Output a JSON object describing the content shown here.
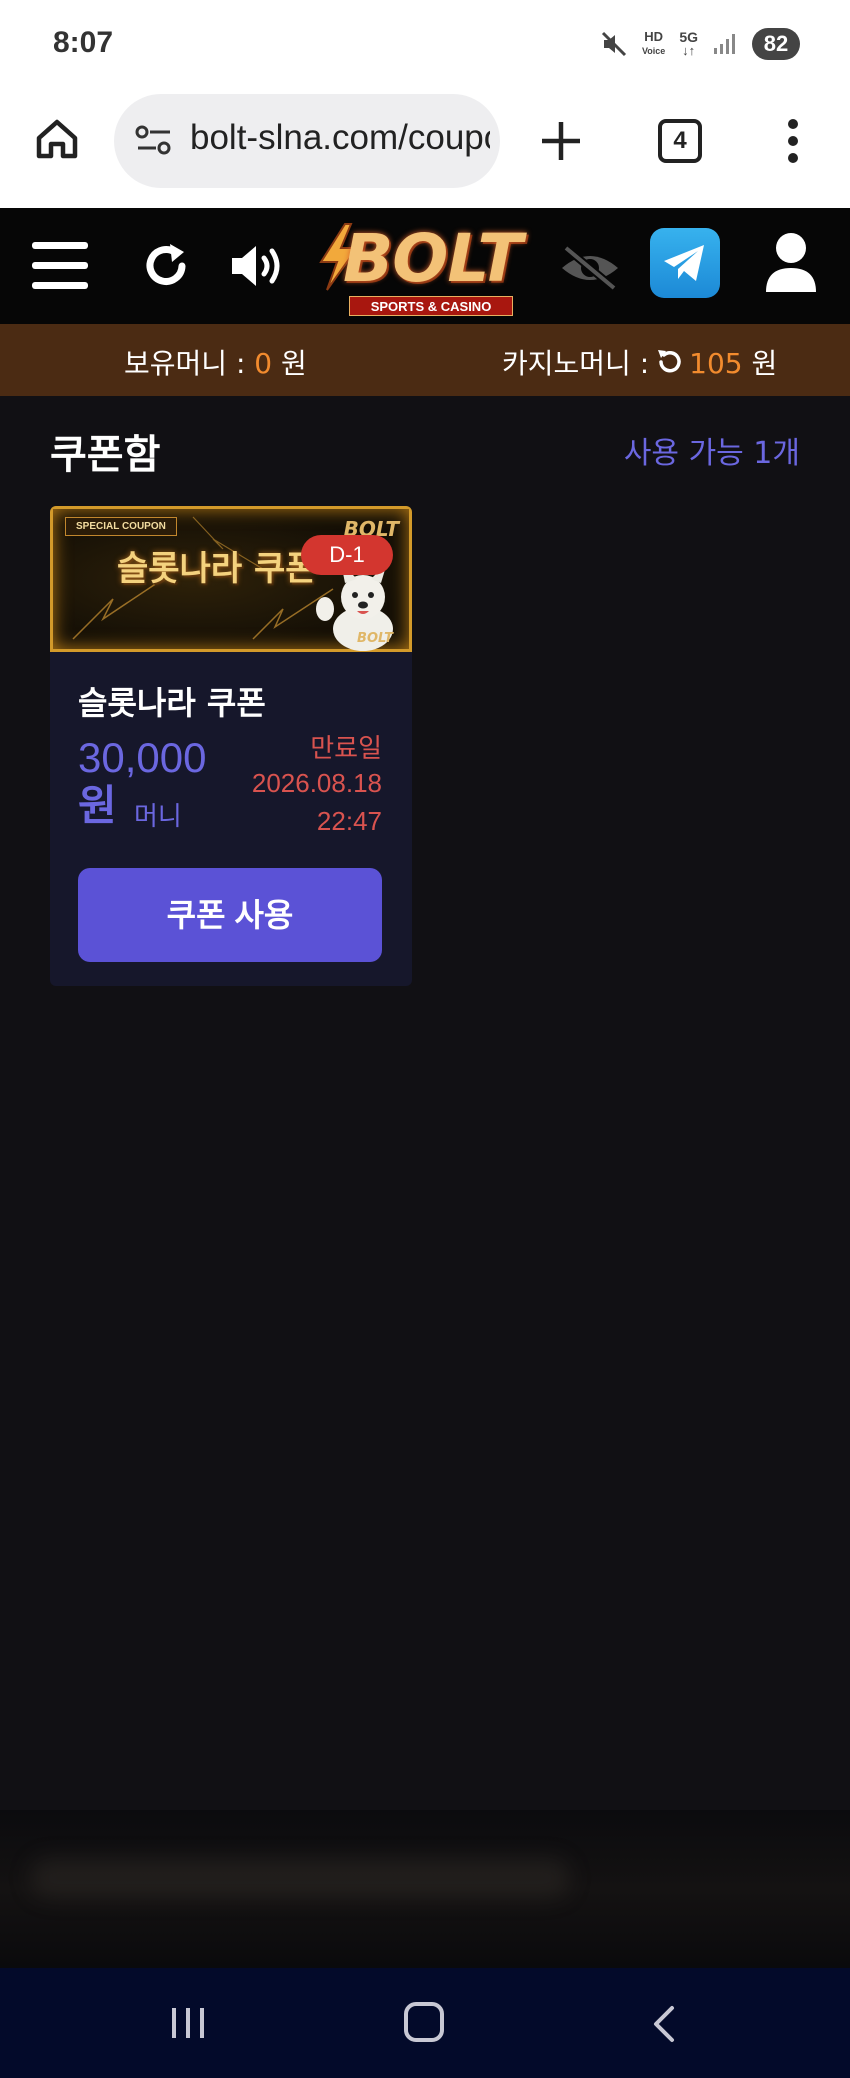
{
  "status_bar": {
    "time": "8:07",
    "icons": [
      "mute-icon",
      "hd-voice-icon",
      "5g-icon",
      "signal-icon"
    ],
    "hd_label": "HD",
    "voice_label": "Voice",
    "network": "5G",
    "battery": "82"
  },
  "browser": {
    "url": "bolt-slna.com/coupon",
    "tab_count": "4"
  },
  "site": {
    "logo_text": "BOLT",
    "logo_sub": "SPORTS & CASINO"
  },
  "balance": {
    "money_label": "보유머니 : ",
    "money_value": "0",
    "money_unit": " 원",
    "casino_label": "카지노머니 : ",
    "casino_value": "105",
    "casino_unit": " 원"
  },
  "page": {
    "title": "쿠폰함",
    "available": "사용 가능 1개"
  },
  "coupon": {
    "banner_special": "SPECIAL COUPON",
    "banner_title": "슬롯나라 쿠폰",
    "banner_brand": "BOLT",
    "dday": "D-1",
    "name": "슬롯나라 쿠폰",
    "amount": "30,000",
    "amount_currency": "원",
    "amount_unit": "머니",
    "expiry_label": "만료일",
    "expiry_date": "2026.08.18",
    "expiry_time": "22:47",
    "use_button": "쿠폰 사용"
  },
  "colors": {
    "accent": "#5b52d6",
    "balance_bar": "#4b2b13",
    "highlight_orange": "#f28b2e",
    "expiry_red": "#d9534f",
    "background": "#111014"
  }
}
